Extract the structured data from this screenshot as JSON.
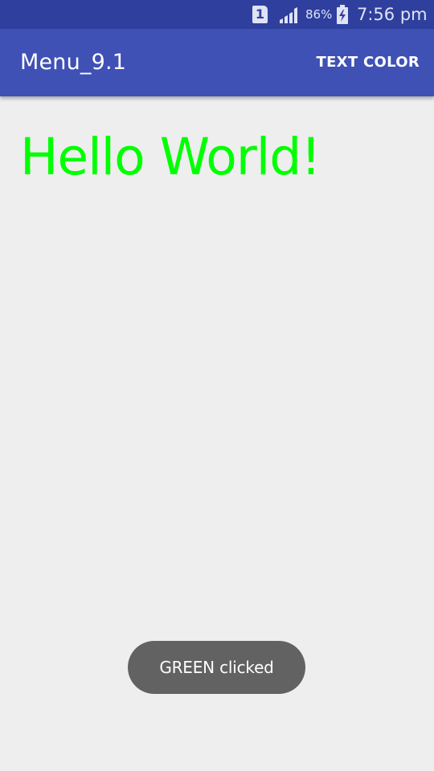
{
  "status_bar": {
    "sim_slot": "1",
    "battery_percent": "86%",
    "time": "7:56 pm",
    "icons": [
      "sim-card-icon",
      "cell-signal-icon",
      "battery-charging-icon"
    ]
  },
  "app_bar": {
    "title": "Menu_9.1",
    "action_label": "TEXT COLOR"
  },
  "main": {
    "hello_text": "Hello World!",
    "text_color": "#00ff00"
  },
  "toast": {
    "message": "GREEN clicked"
  },
  "colors": {
    "status_bar": "#2f3f9e",
    "app_bar": "#3f51b5",
    "background": "#eeeeee",
    "toast": "#626262",
    "hello_text": "#00ff00"
  }
}
